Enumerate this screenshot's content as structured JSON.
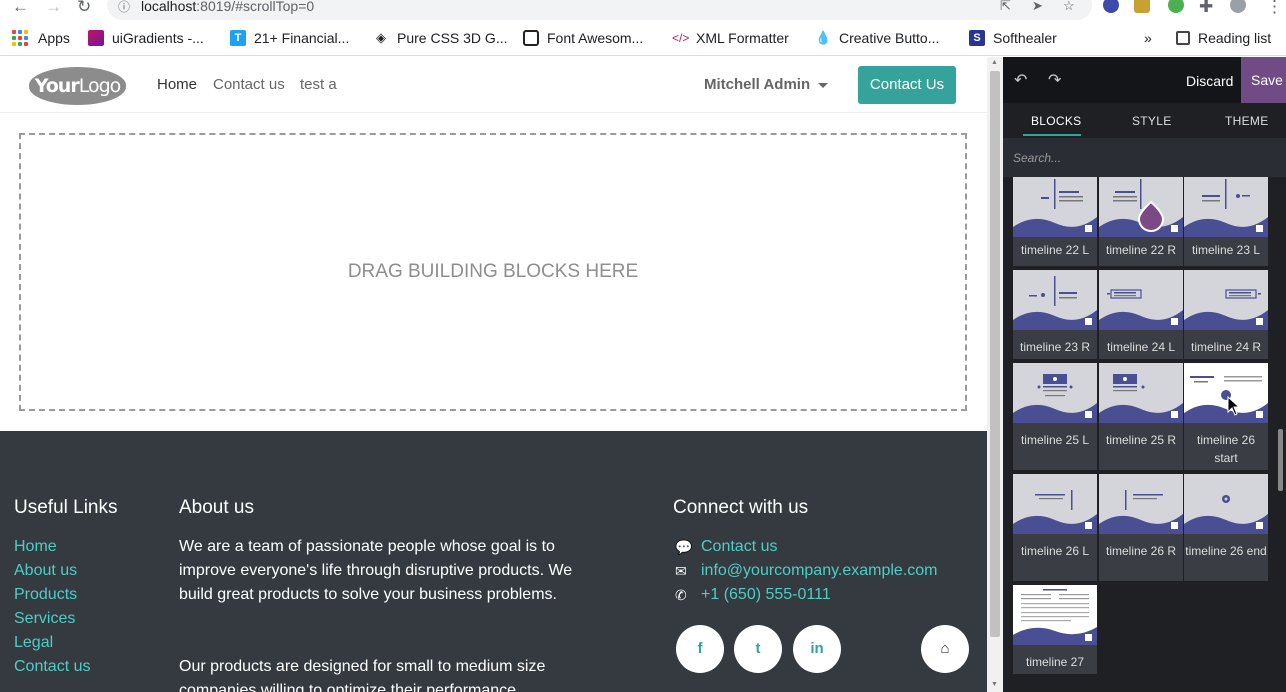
{
  "browser": {
    "url_host": "localhost",
    "url_rest": ":8019/#scrollTop=0",
    "bookmarks": [
      {
        "label": "Apps"
      },
      {
        "label": "uiGradients -..."
      },
      {
        "label": "21+ Financial..."
      },
      {
        "label": "Pure CSS 3D G..."
      },
      {
        "label": "Font Awesom..."
      },
      {
        "label": "XML Formatter"
      },
      {
        "label": "Creative Butto..."
      },
      {
        "label": "Softhealer"
      }
    ],
    "overflow_label": "»",
    "reading_list": "Reading list"
  },
  "site": {
    "logo_bold": "Your",
    "logo_light": "Logo",
    "menu": [
      "Home",
      "Contact us",
      "test a"
    ],
    "user": "Mitchell Admin",
    "cta": "Contact Us",
    "dropzone": "DRAG BUILDING BLOCKS HERE"
  },
  "footer": {
    "useful_links_title": "Useful Links",
    "useful_links": [
      "Home",
      "About us",
      "Products",
      "Services",
      "Legal",
      "Contact us"
    ],
    "about_title": "About us",
    "about_text_1": "We are a team of passionate people whose goal is to improve everyone's life through disruptive products. We build great products to solve your business problems.",
    "about_text_2": "Our products are designed for small to medium size companies willing to optimize their performance.",
    "connect_title": "Connect with us",
    "contact_link": "Contact us",
    "email": "info@yourcompany.example.com",
    "phone": "+1 (650) 555-0111",
    "social": [
      "f",
      "t",
      "in"
    ]
  },
  "panel": {
    "discard": "Discard",
    "save": "Save",
    "tabs": [
      "BLOCKS",
      "STYLE",
      "THEME"
    ],
    "search_placeholder": "Search...",
    "blocks": [
      "timeline 22 L",
      "timeline 22 R",
      "timeline 23 L",
      "timeline 23 R",
      "timeline 24 L",
      "timeline 24 R",
      "timeline 25 L",
      "timeline 25 R",
      "timeline 26 start",
      "timeline 26 L",
      "timeline 26 R",
      "timeline 26 end",
      "timeline 27"
    ]
  },
  "colors": {
    "teal": "#35a39b",
    "footer_bg": "#353a41",
    "panel_bg": "#1e2024",
    "save_bg": "#714b86",
    "wave": "#4a4e92"
  }
}
